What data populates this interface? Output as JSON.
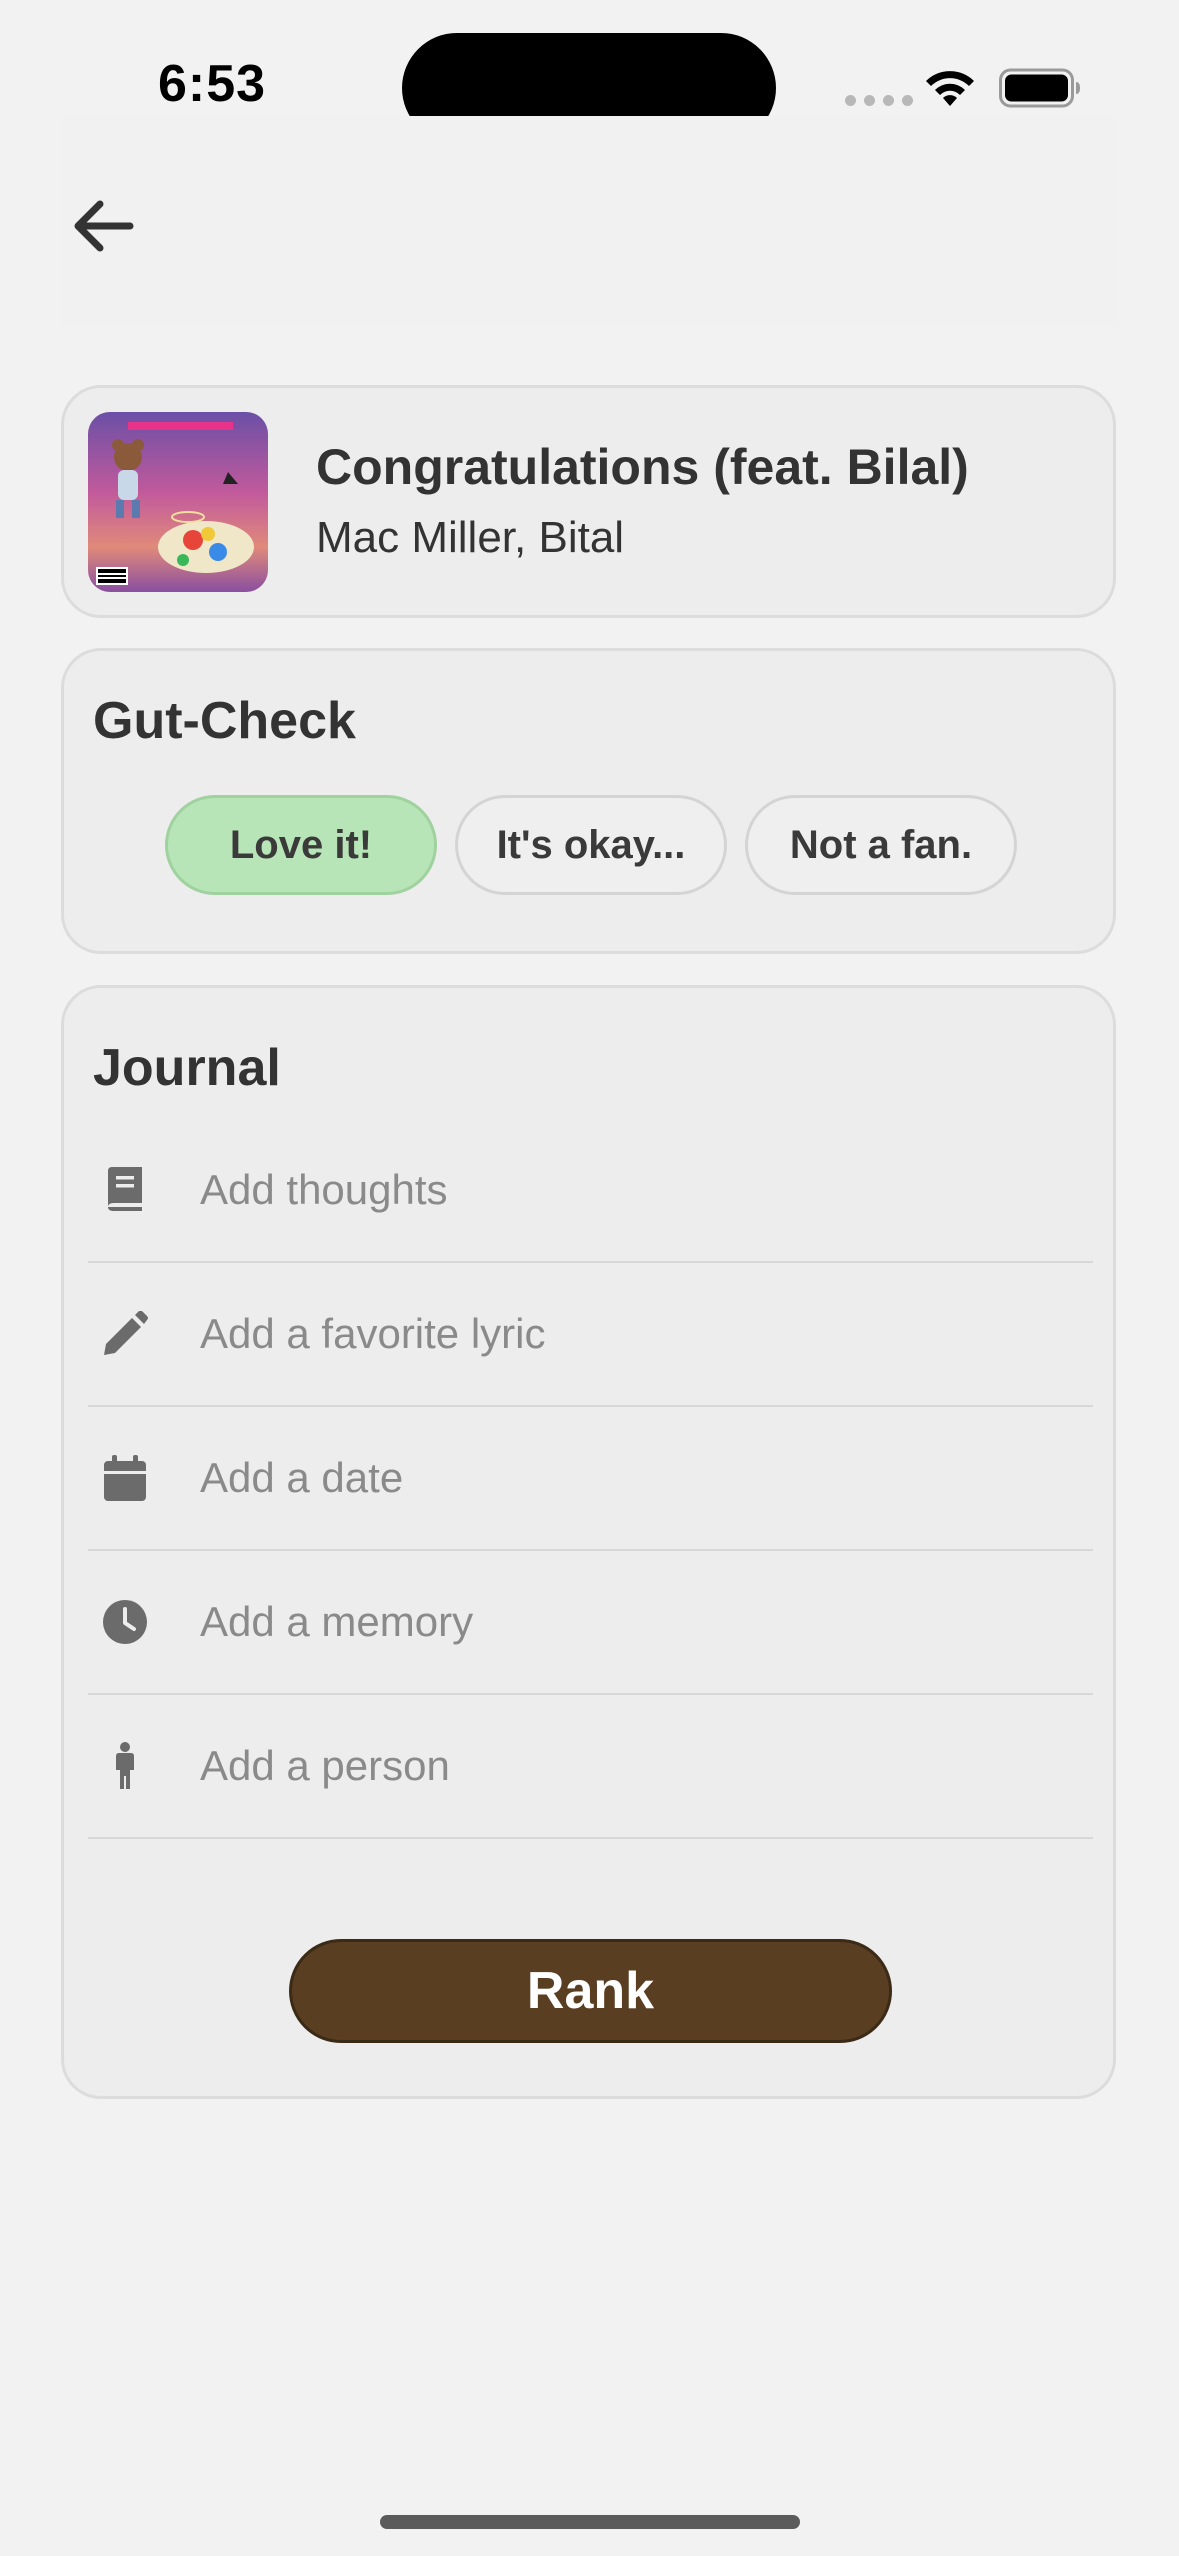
{
  "status_bar": {
    "time": "6:53",
    "icons": [
      "cellular-dots-icon",
      "wifi-icon",
      "battery-icon"
    ]
  },
  "nav": {
    "back_icon": "arrow-left-icon"
  },
  "song": {
    "title": "Congratulations (feat. Bilal)",
    "artist": "Mac Miller, Bital",
    "artwork_icon": "album-art"
  },
  "gut_check": {
    "title": "Gut-Check",
    "options": [
      {
        "label": "Love it!",
        "selected": true
      },
      {
        "label": "It's okay...",
        "selected": false
      },
      {
        "label": "Not a fan.",
        "selected": false
      }
    ],
    "selected_color": "#b8e5b7"
  },
  "journal": {
    "title": "Journal",
    "rows": [
      {
        "icon": "book-icon",
        "placeholder": "Add thoughts"
      },
      {
        "icon": "pencil-icon",
        "placeholder": "Add a favorite lyric"
      },
      {
        "icon": "calendar-icon",
        "placeholder": "Add a date"
      },
      {
        "icon": "clock-icon",
        "placeholder": "Add a memory"
      },
      {
        "icon": "person-icon",
        "placeholder": "Add a person"
      }
    ],
    "rank_label": "Rank",
    "rank_color": "#5a3e22"
  }
}
